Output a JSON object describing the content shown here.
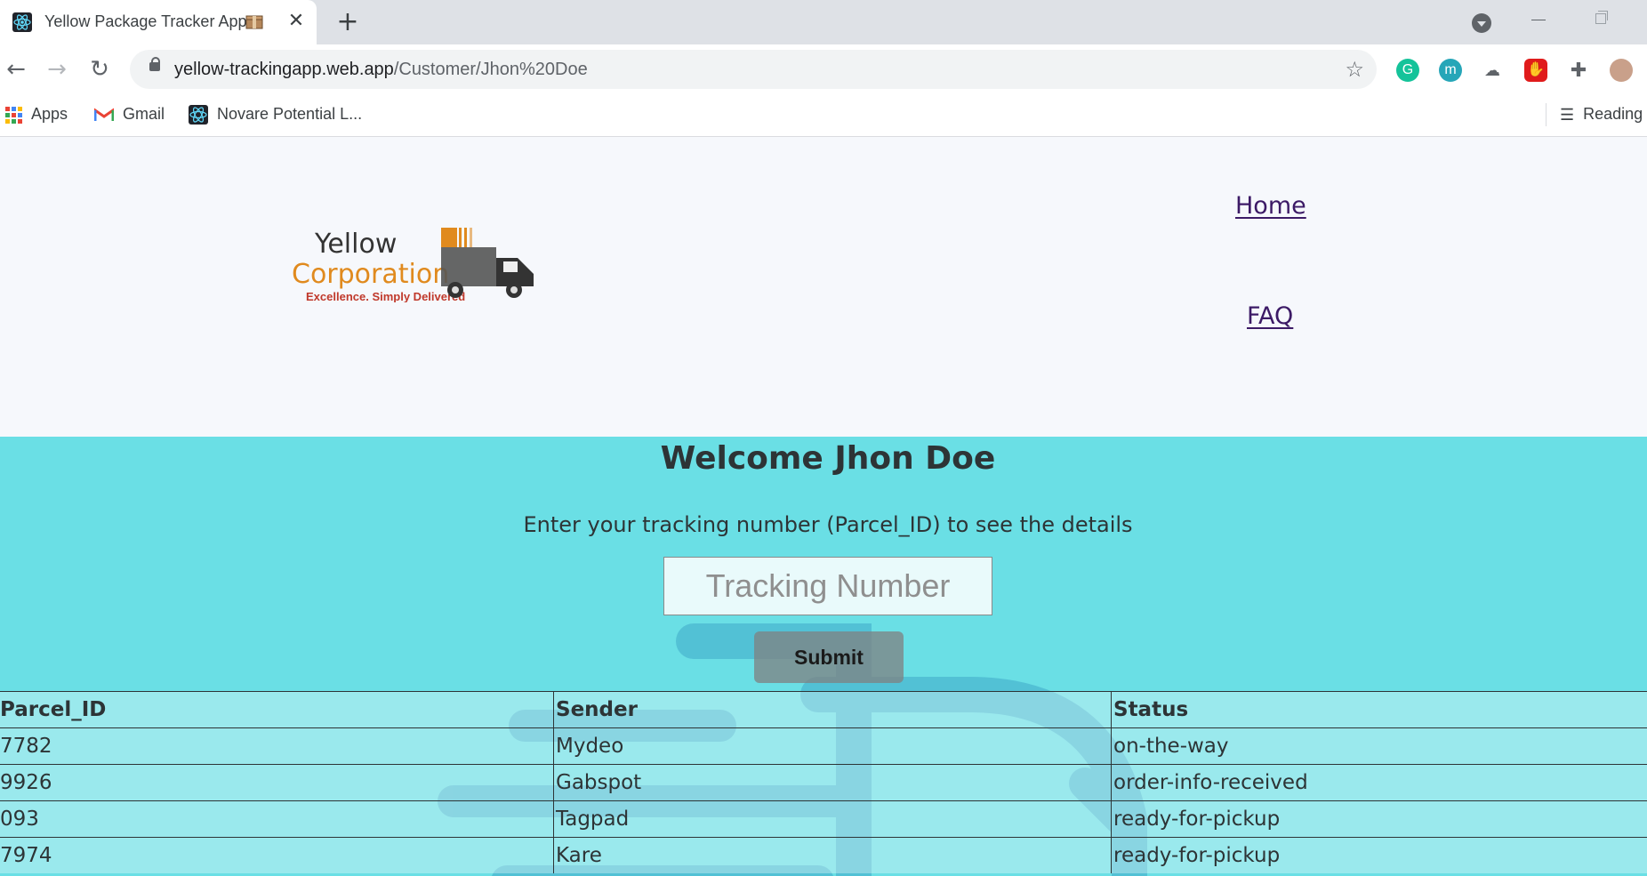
{
  "browser": {
    "tab_title": "Yellow Package Tracker App",
    "url_host": "yellow-trackingapp.web.app",
    "url_path": "/Customer/Jhon%20Doe",
    "bookmarks": [
      {
        "label": "Apps",
        "icon": "apps-grid-icon"
      },
      {
        "label": "Gmail",
        "icon": "gmail-icon"
      },
      {
        "label": "Novare Potential L...",
        "icon": "react-icon"
      }
    ],
    "reading_list": "Reading",
    "extensions": [
      "grammarly-icon",
      "m-extension-icon",
      "cloud-extension-icon",
      "adblock-icon",
      "puzzle-icon",
      "profile-avatar"
    ],
    "colors": {
      "tab_strip": "#dee1e6",
      "omnibox": "#f1f3f4"
    }
  },
  "header": {
    "logo": {
      "line1": "Yellow",
      "line2": "Corporation",
      "tagline": "Excellence. Simply Delivered"
    },
    "nav": {
      "home": "Home",
      "faq": "FAQ"
    }
  },
  "main": {
    "welcome": "Welcome Jhon Doe",
    "instructions": "Enter your tracking number (Parcel_ID) to see the details",
    "tracking_placeholder": "Tracking Number",
    "submit_label": "Submit",
    "table": {
      "headers": [
        "Parcel_ID",
        "Sender",
        "Status"
      ],
      "rows": [
        [
          "7782",
          "Mydeo",
          "on-the-way"
        ],
        [
          "9926",
          "Gabspot",
          "order-info-received"
        ],
        [
          "093",
          "Tagpad",
          "ready-for-pickup"
        ],
        [
          "7974",
          "Kare",
          "ready-for-pickup"
        ]
      ]
    },
    "colors": {
      "background": "#6adfe5",
      "header_background": "#f6f8fc",
      "text": "#2d3436"
    }
  }
}
